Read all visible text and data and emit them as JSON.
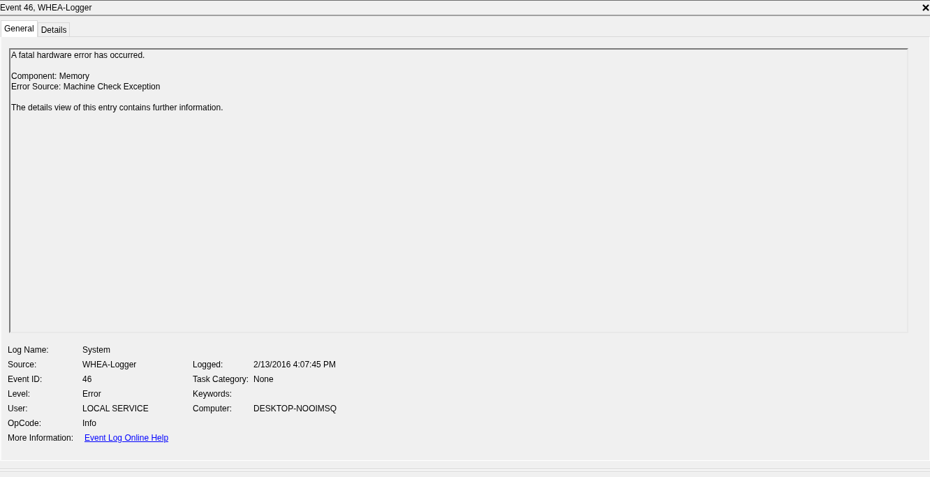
{
  "window": {
    "title": "Event 46, WHEA-Logger"
  },
  "tabs": [
    {
      "label": "General",
      "selected": true
    },
    {
      "label": "Details",
      "selected": false
    }
  ],
  "description": {
    "paragraphs": [
      "A fatal hardware error has occurred.",
      "Component: Memory\nError Source: Machine Check Exception",
      "The details view of this entry contains further information."
    ]
  },
  "properties": [
    {
      "label": "Log Name:",
      "value": "System",
      "kind": "text"
    },
    {
      "label": "Source:",
      "value": "WHEA-Logger",
      "kind": "text"
    },
    {
      "label": "Event ID:",
      "value": "46",
      "kind": "text"
    },
    {
      "label": "Level:",
      "value": "Error",
      "kind": "text"
    },
    {
      "label": "User:",
      "value": "LOCAL SERVICE",
      "kind": "text"
    },
    {
      "label": "OpCode:",
      "value": "Info",
      "kind": "text"
    },
    {
      "label": "More Information:",
      "value": "Event Log Online Help",
      "kind": "link"
    }
  ],
  "properties_right": [
    {
      "label": "Logged:",
      "value": "2/13/2016 4:07:45 PM"
    },
    {
      "label": "Task Category:",
      "value": "None"
    },
    {
      "label": "Keywords:"
    },
    {
      "label": "Computer:",
      "value": "DESKTOP-NOOIMSQ"
    }
  ]
}
